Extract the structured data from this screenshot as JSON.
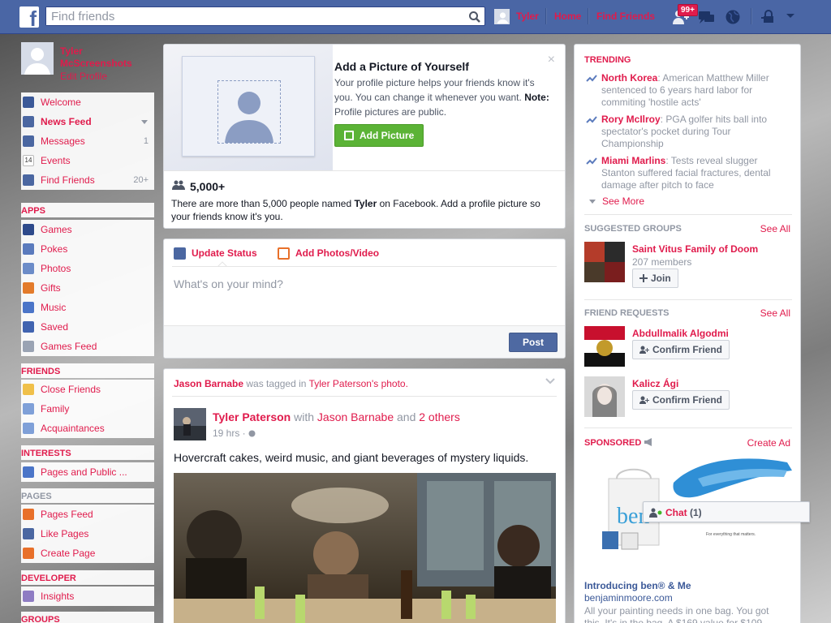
{
  "topbar": {
    "logo": "f",
    "search_placeholder": "Find friends",
    "user_name": "Tyler",
    "home": "Home",
    "find_friends": "Find Friends",
    "notification_badge": "99+"
  },
  "left": {
    "profile_name": "Tyler McScreenshots",
    "edit_profile": "Edit Profile",
    "main_items": [
      {
        "label": "Welcome",
        "count": ""
      },
      {
        "label": "News Feed",
        "count": ""
      },
      {
        "label": "Messages",
        "count": "1"
      },
      {
        "label": "Events",
        "count": ""
      },
      {
        "label": "Find Friends",
        "count": "20+"
      }
    ],
    "apps_header": "APPS",
    "apps": [
      "Games",
      "Pokes",
      "Photos",
      "Gifts",
      "Music",
      "Saved",
      "Games Feed"
    ],
    "friends_header": "FRIENDS",
    "friends": [
      "Close Friends",
      "Family",
      "Acquaintances"
    ],
    "interests_header": "INTERESTS",
    "interests": [
      "Pages and Public ..."
    ],
    "pages_header": "PAGES",
    "pages": [
      "Pages Feed",
      "Like Pages",
      "Create Page"
    ],
    "developer_header": "DEVELOPER",
    "developer": [
      "Insights"
    ],
    "groups_header": "GROUPS"
  },
  "addpic": {
    "title": "Add a Picture of Yourself",
    "text": "Your profile picture helps your friends know it's you. You can change it whenever you want.",
    "note_label": "Note:",
    "note_text": " Profile pictures are public.",
    "button": "Add Picture",
    "count": "5,000+",
    "desc_pre": "There are more than 5,000 people named ",
    "desc_name": "Tyler",
    "desc_post": " on Facebook. Add a profile picture so your friends know it's you."
  },
  "composer": {
    "tab_status": "Update Status",
    "tab_photos": "Add Photos/Video",
    "placeholder": "What's on your mind?",
    "post": "Post"
  },
  "story": {
    "tagger": "Jason Barnabe",
    "was_tagged": " was tagged in ",
    "owner": "Tyler Paterson",
    "photo_suffix": "'s photo.",
    "author": "Tyler Paterson",
    "with": " with ",
    "with_name": "Jason Barnabe",
    "and": " and ",
    "others": "2 others",
    "time": "19 hrs · ",
    "text": "Hovercraft cakes, weird music, and giant beverages of mystery liquids."
  },
  "right": {
    "trending_header": "TRENDING",
    "trends": [
      {
        "topic": "North Korea",
        "text": ": American Matthew Miller sentenced to 6 years hard labor for commiting 'hostile acts'"
      },
      {
        "topic": "Rory McIlroy",
        "text": ": PGA golfer hits ball into spectator's pocket during Tour Championship"
      },
      {
        "topic": "Miami Marlins",
        "text": ": Tests reveal slugger Stanton suffered facial fractures, dental damage after pitch to face"
      }
    ],
    "see_more": "See More",
    "groups_header": "SUGGESTED GROUPS",
    "see_all": "See All",
    "group_name": "Saint Vitus Family of Doom",
    "group_members": "207 members",
    "join": "Join",
    "requests_header": "FRIEND REQUESTS",
    "requests": [
      {
        "name": "Abdullmalik Algodmi",
        "button": "Confirm Friend"
      },
      {
        "name": "Kalicz Ági",
        "button": "Confirm Friend"
      }
    ],
    "sponsored_header": "SPONSORED",
    "create_ad": "Create Ad",
    "ad_title": "Introducing ben® & Me",
    "ad_url": "benjaminmoore.com",
    "ad_text": "All your painting needs in one bag. You got this. It's in the bag. A $169 value for $109",
    "ad_brand": "ben",
    "ad_tagline": "For everything that matters."
  },
  "chat": {
    "label": "Chat",
    "count": "(1)"
  },
  "colors": {
    "accent": "#e01b4c",
    "topbar": "#4a66a5",
    "button_green": "#5bb336",
    "post_blue": "#4e69a2"
  }
}
